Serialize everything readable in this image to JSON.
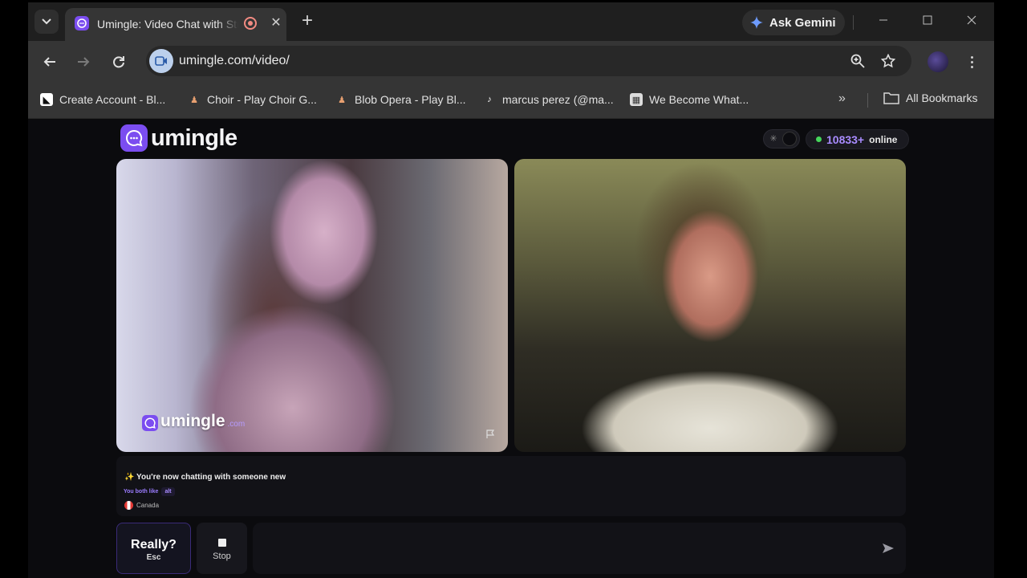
{
  "browser": {
    "tab": {
      "title": "Umingle: Video Chat with Strangers"
    },
    "gemini_label": "Ask Gemini",
    "url": "umingle.com/video/",
    "bookmarks": [
      {
        "label": "Create Account - Bl...",
        "icon": "create-account-icon"
      },
      {
        "label": "Choir - Play Choir G...",
        "icon": "choir-icon"
      },
      {
        "label": "Blob Opera - Play Bl...",
        "icon": "blob-opera-icon"
      },
      {
        "label": "marcus perez (@ma...",
        "icon": "tiktok-icon"
      },
      {
        "label": "We Become What...",
        "icon": "we-become-icon"
      }
    ],
    "all_bookmarks_label": "All Bookmarks"
  },
  "page": {
    "logo_text": "umingle",
    "online_count": "10833+",
    "online_label": "online",
    "watermark_text": "umingle",
    "watermark_sub": ".com",
    "chat": {
      "new_message": "✨ You're now chatting with someone new",
      "likes_label": "You both like",
      "interest": "alt",
      "country": "Canada"
    },
    "buttons": {
      "really_label": "Really?",
      "really_sub": "Esc",
      "stop_label": "Stop"
    },
    "message_input": {
      "value": "",
      "placeholder": ""
    }
  },
  "colors": {
    "brand": "#7b4df0",
    "online_dot": "#45d65b",
    "online_count": "#a88bff"
  }
}
